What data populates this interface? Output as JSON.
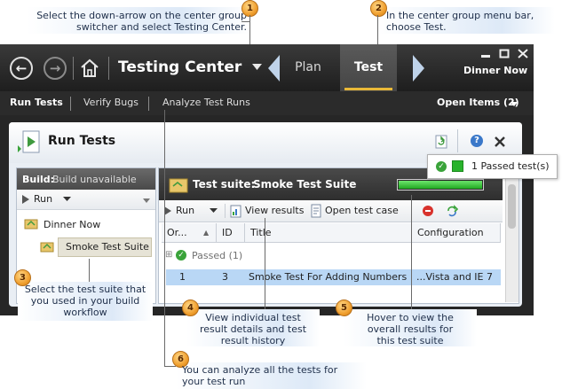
{
  "callouts": [
    {
      "num": "1",
      "text_a": "Select the down-arrow on the center group",
      "text_b": "switcher and select Testing Center."
    },
    {
      "num": "2",
      "text_a": "In the center group menu bar,",
      "text_b": "choose Test."
    },
    {
      "num": "3",
      "text_a": "Select the test suite that",
      "text_b": "you used in your build",
      "text_c": "workflow"
    },
    {
      "num": "4",
      "text_a": "View individual test",
      "text_b": "result details and test",
      "text_c": "result history"
    },
    {
      "num": "5",
      "text_a": "Hover to view the",
      "text_b": "overall results for",
      "text_c": "this test suite"
    },
    {
      "num": "6",
      "text_a": "You can analyze all the tests for",
      "text_b": "your test run"
    }
  ],
  "topbar": {
    "title": "Testing Center",
    "tabs": [
      "Plan",
      "Test"
    ],
    "user": "Dinner Now",
    "window_icons": [
      "minimize-icon",
      "maximize-icon",
      "close-icon"
    ]
  },
  "subnav": {
    "items": [
      "Run Tests",
      "Verify Bugs",
      "Analyze Test Runs"
    ],
    "open_items": "Open Items (2)"
  },
  "panel": {
    "title": "Run Tests",
    "build_label": "Build:",
    "build_value": "Build unavailable",
    "run_label": "Run",
    "tree": [
      "Dinner Now",
      "Smoke Test Suite"
    ]
  },
  "suite": {
    "label": "Test suite:",
    "name": "Smoke Test Suite",
    "progress": 1.0
  },
  "toolbar": {
    "run": "Run",
    "view_results": "View results",
    "open_test_case": "Open test case"
  },
  "table": {
    "columns": [
      "Or...",
      "ID",
      "Title",
      "Configuration"
    ],
    "group": "Passed (1)",
    "row": {
      "order": "1",
      "id": "3",
      "title": "Smoke Test For Adding Numbers",
      "config": "...Vista and IE 7"
    }
  },
  "tooltip": {
    "text": "1 Passed test(s)"
  },
  "colors": {
    "accent": "#e8b838",
    "pass": "#29b32c",
    "selection": "#b9d7f5"
  }
}
